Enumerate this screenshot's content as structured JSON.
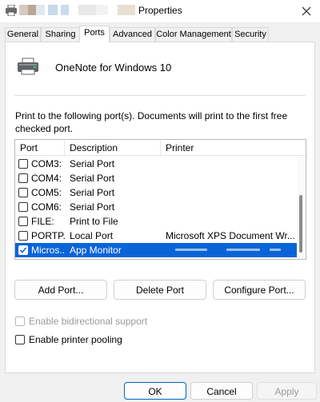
{
  "window": {
    "title": "Properties"
  },
  "colors": {
    "accent": "#0a64d8",
    "swatches": [
      "#d8c9c0",
      "#b9a799",
      "#e0e8f2",
      "#c8d8ea",
      "#c8dbf0",
      "#e8e8e8",
      "#f2f2f2",
      "#e8ded3"
    ]
  },
  "tabs": [
    {
      "label": "General",
      "active": false
    },
    {
      "label": "Sharing",
      "active": false
    },
    {
      "label": "Ports",
      "active": true
    },
    {
      "label": "Advanced",
      "active": false
    },
    {
      "label": "Color Management",
      "active": false
    },
    {
      "label": "Security",
      "active": false
    }
  ],
  "printer": {
    "name": "OneNote for Windows 10",
    "icon": "printer-icon"
  },
  "description": "Print to the following port(s). Documents will print to the first free checked port.",
  "ports": {
    "columns": [
      "Port",
      "Description",
      "Printer"
    ],
    "rows": [
      {
        "port": "COM3:",
        "description": "Serial Port",
        "printer": "",
        "checked": false,
        "selected": false
      },
      {
        "port": "COM4:",
        "description": "Serial Port",
        "printer": "",
        "checked": false,
        "selected": false
      },
      {
        "port": "COM5:",
        "description": "Serial Port",
        "printer": "",
        "checked": false,
        "selected": false
      },
      {
        "port": "COM6:",
        "description": "Serial Port",
        "printer": "",
        "checked": false,
        "selected": false
      },
      {
        "port": "FILE:",
        "description": "Print to File",
        "printer": "",
        "checked": false,
        "selected": false
      },
      {
        "port": "PORTP...",
        "description": "Local Port",
        "printer": "Microsoft XPS Document Wr...",
        "checked": false,
        "selected": false
      },
      {
        "port": "Micros...",
        "description": "App Monitor",
        "printer": "",
        "checked": true,
        "selected": true
      }
    ]
  },
  "port_buttons": {
    "add": "Add Port...",
    "delete": "Delete Port",
    "configure": "Configure Port..."
  },
  "options": {
    "bidirectional": {
      "label": "Enable bidirectional support",
      "checked": false,
      "enabled": false
    },
    "pooling": {
      "label": "Enable printer pooling",
      "checked": false,
      "enabled": true
    }
  },
  "dialog_buttons": {
    "ok": "OK",
    "cancel": "Cancel",
    "apply": "Apply"
  }
}
